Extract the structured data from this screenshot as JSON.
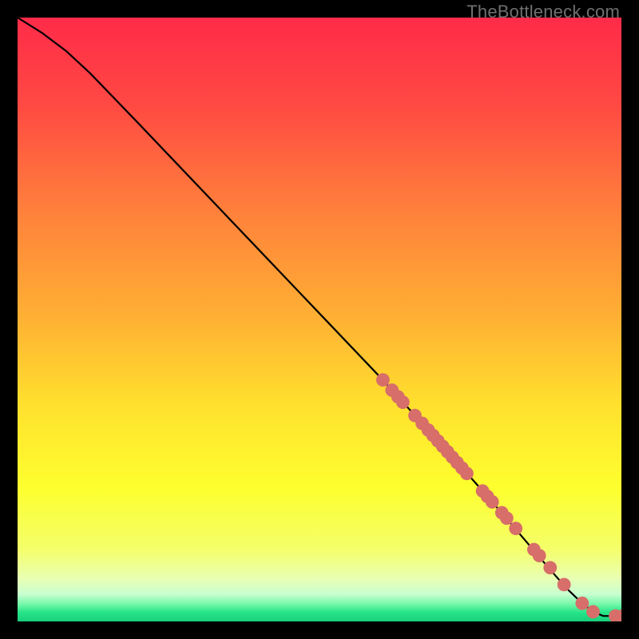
{
  "watermark": "TheBottleneck.com",
  "chart_data": {
    "type": "line",
    "title": "",
    "xlabel": "",
    "ylabel": "",
    "xlim": [
      0,
      100
    ],
    "ylim": [
      0,
      100
    ],
    "background_gradient": {
      "stops": [
        {
          "offset": 0.0,
          "color": "#ff2b49"
        },
        {
          "offset": 0.14,
          "color": "#ff4843"
        },
        {
          "offset": 0.32,
          "color": "#ff803b"
        },
        {
          "offset": 0.5,
          "color": "#ffb133"
        },
        {
          "offset": 0.64,
          "color": "#ffe02d"
        },
        {
          "offset": 0.78,
          "color": "#fdff2e"
        },
        {
          "offset": 0.88,
          "color": "#f4ff6a"
        },
        {
          "offset": 0.93,
          "color": "#e8ffb5"
        },
        {
          "offset": 0.955,
          "color": "#c8ffd0"
        },
        {
          "offset": 0.972,
          "color": "#71f7a8"
        },
        {
          "offset": 0.985,
          "color": "#26e588"
        },
        {
          "offset": 1.0,
          "color": "#18cf7c"
        }
      ]
    },
    "series": [
      {
        "name": "curve",
        "x": [
          0,
          4,
          8,
          12,
          20,
          30,
          40,
          50,
          60,
          70,
          78,
          84,
          88,
          91,
          93.5,
          95.3,
          97,
          100
        ],
        "y": [
          100,
          97.5,
          94.5,
          90.8,
          82.5,
          72,
          61.5,
          51,
          40.5,
          29.5,
          20.5,
          13.5,
          8.8,
          5.4,
          3.0,
          1.6,
          0.9,
          0.9
        ]
      }
    ],
    "scatter": {
      "name": "points",
      "color": "#d76e6a",
      "radius": 8.4,
      "x": [
        60.5,
        62.0,
        63.0,
        63.8,
        65.8,
        67.0,
        68.0,
        68.8,
        69.6,
        70.4,
        71.2,
        72.0,
        72.8,
        73.6,
        74.4,
        77.0,
        77.8,
        78.6,
        80.2,
        81.0,
        82.5,
        85.5,
        86.4,
        88.2,
        90.5,
        93.5,
        95.3,
        99.0,
        100.2
      ],
      "y": [
        40.0,
        38.3,
        37.2,
        36.3,
        34.1,
        32.8,
        31.7,
        30.8,
        29.9,
        29.0,
        28.1,
        27.2,
        26.3,
        25.4,
        24.5,
        21.6,
        20.7,
        19.8,
        18.0,
        17.1,
        15.4,
        11.9,
        10.9,
        8.9,
        6.1,
        3.0,
        1.6,
        0.9,
        0.9
      ]
    }
  }
}
